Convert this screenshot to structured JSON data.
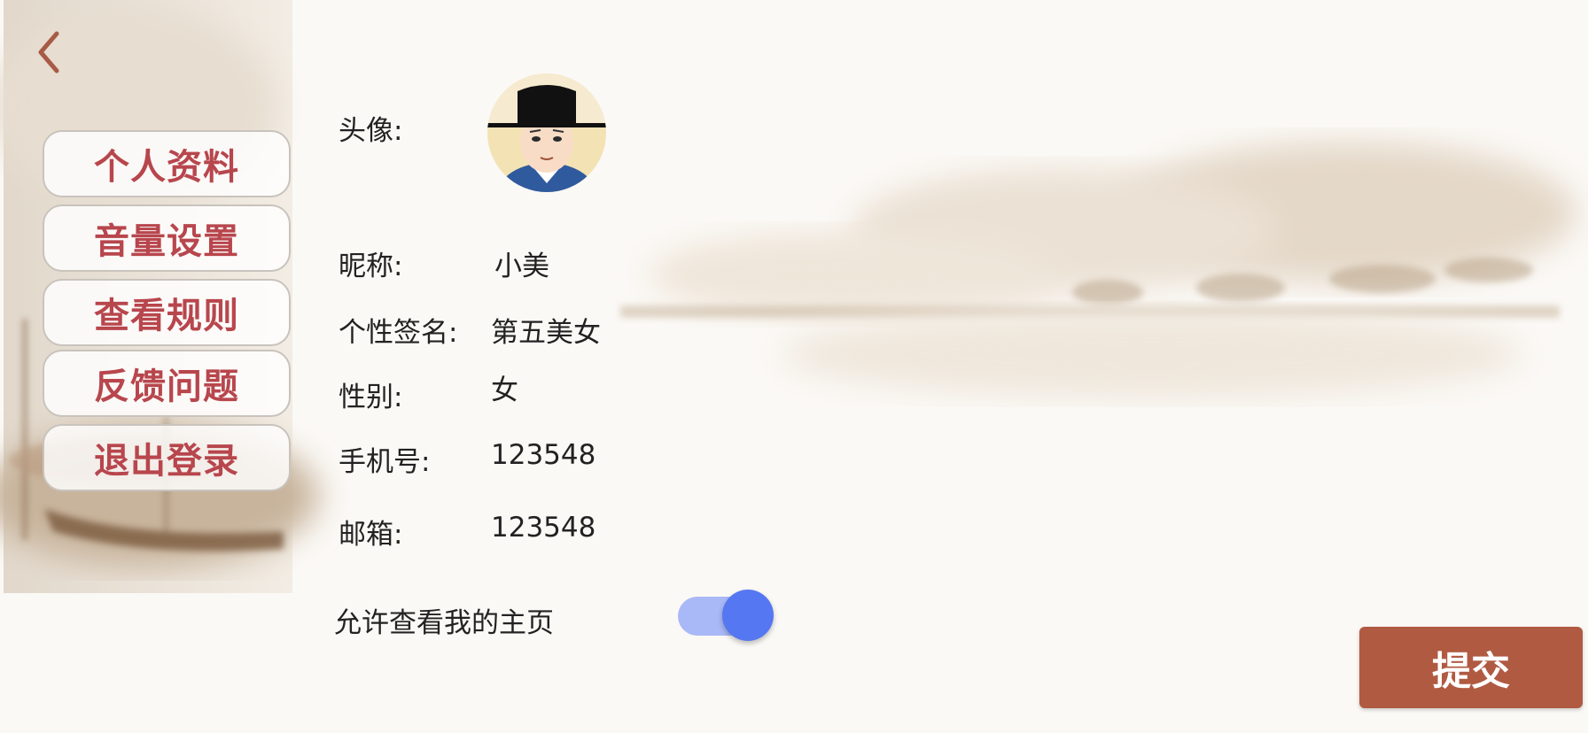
{
  "nav": {
    "back_icon": "chevron-left-icon"
  },
  "sidebar": {
    "items": [
      {
        "label": "个人资料"
      },
      {
        "label": "音量设置"
      },
      {
        "label": "查看规则"
      },
      {
        "label": "反馈问题"
      },
      {
        "label": "退出登录"
      }
    ]
  },
  "profile": {
    "avatar_label": "头像:",
    "nickname_label": "昵称:",
    "nickname": "小美",
    "signature_label": "个性签名:",
    "signature": "第五美女",
    "gender_label": "性别:",
    "gender": "女",
    "phone_label": "手机号:",
    "phone": "123548",
    "email_label": "邮箱:",
    "email": "123548"
  },
  "settings": {
    "allow_homepage_label": "允许查看我的主页",
    "allow_homepage_on": true
  },
  "actions": {
    "submit_label": "提交"
  },
  "colors": {
    "menu_text": "#b8464d",
    "submit_bg": "#b05a42",
    "toggle_knob": "#5677f2",
    "toggle_track": "#a9b8f7"
  }
}
